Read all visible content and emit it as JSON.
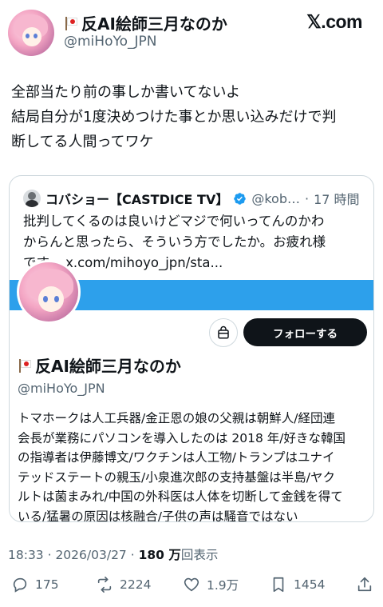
{
  "header": {
    "display_name": "反AI絵師三月なのか",
    "handle": "@miHoYo_JPN",
    "site_logo": "𝕏.com"
  },
  "post": {
    "lines": [
      "全部当たり前の事しか書いてないよ",
      "結局自分が1度決めつけた事とか思い込みだけで判",
      "断してる人間ってワケ"
    ]
  },
  "quote": {
    "name": "コバショー【CASTDICE TV】",
    "handle": "@kob…",
    "separator": "·",
    "time": "17 時間",
    "text_lines": [
      "批判してくるのは良いけどマジで何いってんのかわ",
      "からんと思ったら、そういう方でしたか。お疲れ様",
      "です。 x.com/mihoyo_jpn/sta..."
    ],
    "banner_color": "#2da0eb",
    "profile": {
      "name": "反AI絵師三月なのか",
      "handle": "@miHoYo_JPN",
      "follow_label": "フォローする",
      "bio_lines": [
        "トマホークは人工兵器/金正恩の娘の父親は朝鮮人/経団連",
        "会長が業務にパソコンを導入したのは 2018 年/好きな韓国",
        "の指導者は伊藤博文/ワクチンは人工物/トランプはユナイ",
        "テッドステートの親玉/小泉進次郎の支持基盤は半島/ヤク",
        "ルトは菌まみれ/中国の外科医は人体を切断して金銭を得て",
        "いる/猛暑の原因は核融合/子供の声は騒音ではない"
      ]
    }
  },
  "meta": {
    "time": "18:33 · 2026/03/27 · ",
    "views_count": "180 万",
    "views_label": "回表示"
  },
  "actions": {
    "replies": "175",
    "reposts": "2224",
    "likes": "1.9万",
    "bookmarks": "1454"
  },
  "colors": {
    "text": "#0f1419",
    "muted": "#536471",
    "border": "#cfd9de",
    "verified": "#1d9bf0",
    "repost": "#536471"
  }
}
